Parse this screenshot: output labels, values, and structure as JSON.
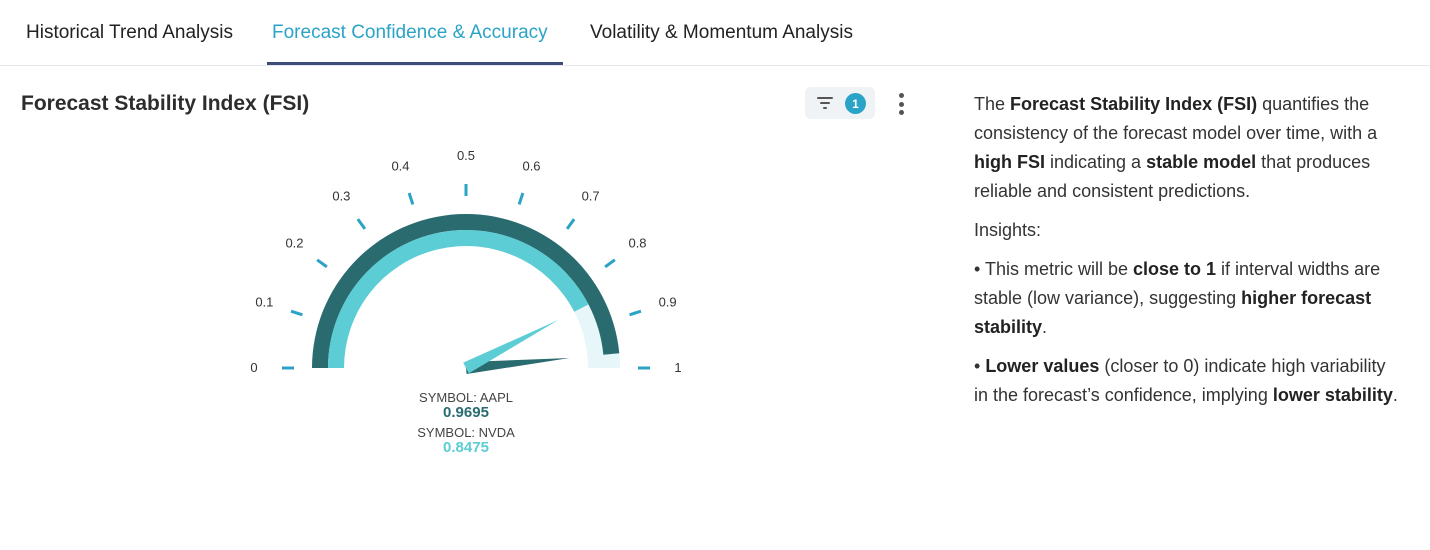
{
  "tabs": [
    {
      "label": "Historical Trend Analysis",
      "active": false
    },
    {
      "label": "Forecast Confidence & Accuracy",
      "active": true
    },
    {
      "label": "Volatility & Momentum Analysis",
      "active": false
    }
  ],
  "card": {
    "title": "Forecast Stability Index (FSI)",
    "filter_count": "1",
    "filter_icon": "filter-icon",
    "more_icon": "more-vertical-icon"
  },
  "chart_data": {
    "type": "gauge",
    "range": [
      0,
      1
    ],
    "tick_labels": [
      "0",
      "0.1",
      "0.2",
      "0.3",
      "0.4",
      "0.5",
      "0.6",
      "0.7",
      "0.8",
      "0.9",
      "1"
    ],
    "series": [
      {
        "name": "AAPL",
        "label": "SYMBOL: AAPL",
        "value": 0.9695,
        "value_text": "0.9695",
        "color": "#2a6b6f"
      },
      {
        "name": "NVDA",
        "label": "SYMBOL: NVDA",
        "value": 0.8475,
        "value_text": "0.8475",
        "color": "#5ccdd4"
      }
    ],
    "track_color": "#e6f6f9",
    "tick_color": "#2aa3c7"
  },
  "description": {
    "p1": [
      {
        "t": "The ",
        "b": false
      },
      {
        "t": "Forecast Stability Index (FSI)",
        "b": true
      },
      {
        "t": " quantifies the consistency of the forecast model over time, with a ",
        "b": false
      },
      {
        "t": "high FSI",
        "b": true
      },
      {
        "t": " indicating a ",
        "b": false
      },
      {
        "t": "stable model",
        "b": true
      },
      {
        "t": " that produces reliable and consistent predictions.",
        "b": false
      }
    ],
    "insights_label": "Insights:",
    "bullet1": [
      {
        "t": "• This metric will be ",
        "b": false
      },
      {
        "t": "close to 1",
        "b": true
      },
      {
        "t": " if interval widths are stable (low variance), suggesting ",
        "b": false
      },
      {
        "t": "higher forecast stability",
        "b": true
      },
      {
        "t": ".",
        "b": false
      }
    ],
    "bullet2": [
      {
        "t": "• ",
        "b": false
      },
      {
        "t": "Lower values",
        "b": true
      },
      {
        "t": " (closer to 0) indicate high variability in the forecast’s confidence, implying ",
        "b": false
      },
      {
        "t": "lower stability",
        "b": true
      },
      {
        "t": ".",
        "b": false
      }
    ]
  }
}
